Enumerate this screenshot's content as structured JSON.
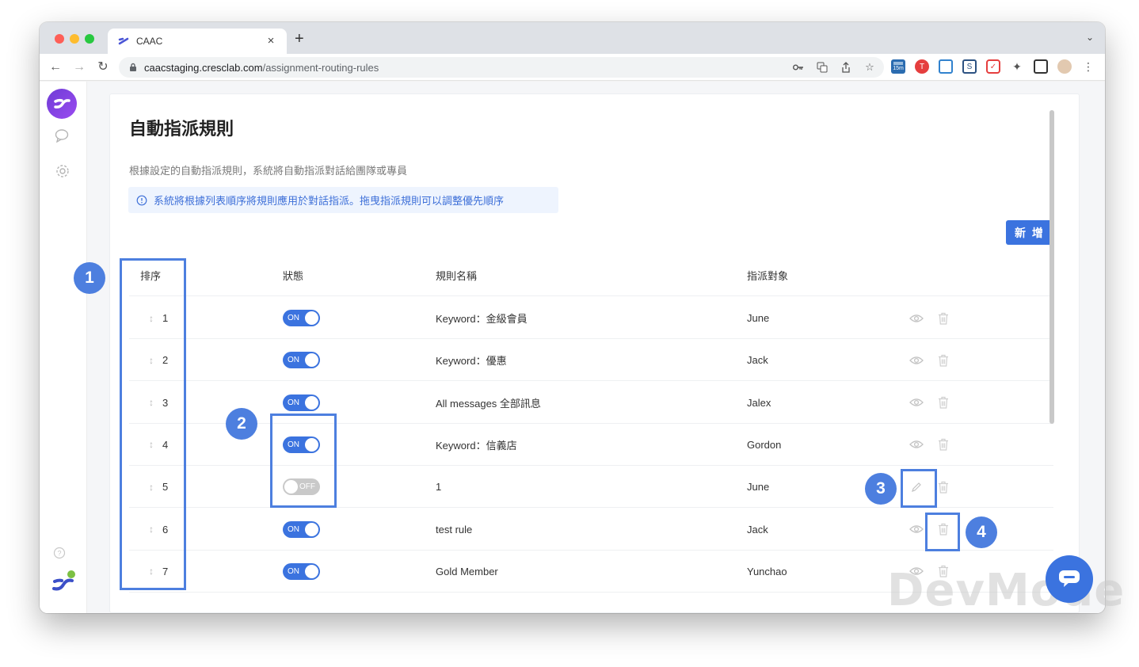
{
  "browser": {
    "tab_title": "CAAC",
    "tab_close": "×",
    "new_tab": "+",
    "url_host": "caacstaging.cresclab.com",
    "url_path": "/assignment-routing-rules",
    "ext_badge": "15m"
  },
  "page": {
    "title": "自動指派規則",
    "description": "根據設定的自動指派規則，系統將自動指派對話給團隊或專員",
    "info": "系統將根據列表順序將規則應用於對話指派。拖曳指派規則可以調整優先順序",
    "add_button": "新 增"
  },
  "table": {
    "columns": {
      "order": "排序",
      "status": "狀態",
      "name": "規則名稱",
      "assignee": "指派對象"
    },
    "drag_glyph": "↕",
    "on_label": "ON",
    "off_label": "OFF",
    "rows": [
      {
        "order": "1",
        "status": "on",
        "name": "Keyword：金級會員",
        "assignee": "June"
      },
      {
        "order": "2",
        "status": "on",
        "name": "Keyword：優惠",
        "assignee": "Jack"
      },
      {
        "order": "3",
        "status": "on",
        "name": "All messages 全部訊息",
        "assignee": "Jalex"
      },
      {
        "order": "4",
        "status": "on",
        "name": "Keyword：信義店",
        "assignee": "Gordon"
      },
      {
        "order": "5",
        "status": "off",
        "name": "1",
        "assignee": "June"
      },
      {
        "order": "6",
        "status": "on",
        "name": "test rule",
        "assignee": "Jack"
      },
      {
        "order": "7",
        "status": "on",
        "name": "Gold Member",
        "assignee": "Yunchao"
      }
    ]
  },
  "annotations": {
    "b1": "1",
    "b2": "2",
    "b3": "3",
    "b4": "4"
  },
  "watermark": "DevMode",
  "colors": {
    "accent": "#3b73df",
    "annotation": "#4d7fdf",
    "toggle_off": "#c9c9c9"
  },
  "icons": [
    "lock-icon",
    "key-icon",
    "translate-icon",
    "share-icon",
    "star-icon",
    "puzzle-icon",
    "eye-icon",
    "pencil-icon",
    "trash-icon",
    "chat-icon",
    "gear-icon",
    "help-icon"
  ]
}
